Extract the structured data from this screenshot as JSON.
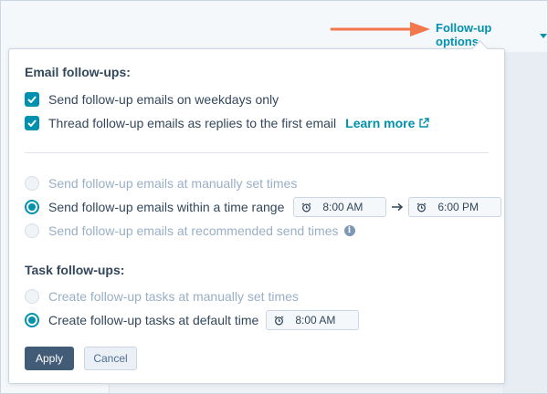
{
  "header": {
    "trigger_label": "Follow-up options",
    "accent_color": "#0091ae",
    "arrow_color": "#f2784b"
  },
  "email_section": {
    "title": "Email follow-ups:",
    "checkboxes": [
      {
        "label": "Send follow-up emails on weekdays only",
        "checked": true
      },
      {
        "label": "Thread follow-up emails as replies to the first email",
        "checked": true,
        "link": "Learn more"
      }
    ],
    "radios": [
      {
        "label": "Send follow-up emails at manually set times",
        "selected": false,
        "disabled": true
      },
      {
        "label": "Send follow-up emails within a time range",
        "selected": true,
        "start_time": "8:00 AM",
        "end_time": "6:00 PM"
      },
      {
        "label": "Send follow-up emails at recommended send times",
        "selected": false,
        "disabled": true,
        "info_icon": "i"
      }
    ]
  },
  "task_section": {
    "title": "Task follow-ups:",
    "radios": [
      {
        "label": "Create follow-up tasks at manually set times",
        "selected": false,
        "disabled": true
      },
      {
        "label": "Create follow-up tasks at default time",
        "selected": true,
        "time": "8:00 AM"
      }
    ]
  },
  "buttons": {
    "apply": "Apply",
    "cancel": "Cancel"
  },
  "icons": {
    "check": "check-icon",
    "external": "external-link-icon",
    "clock": "alarm-clock-icon",
    "arrow": "arrow-right-icon",
    "info": "info-icon"
  }
}
